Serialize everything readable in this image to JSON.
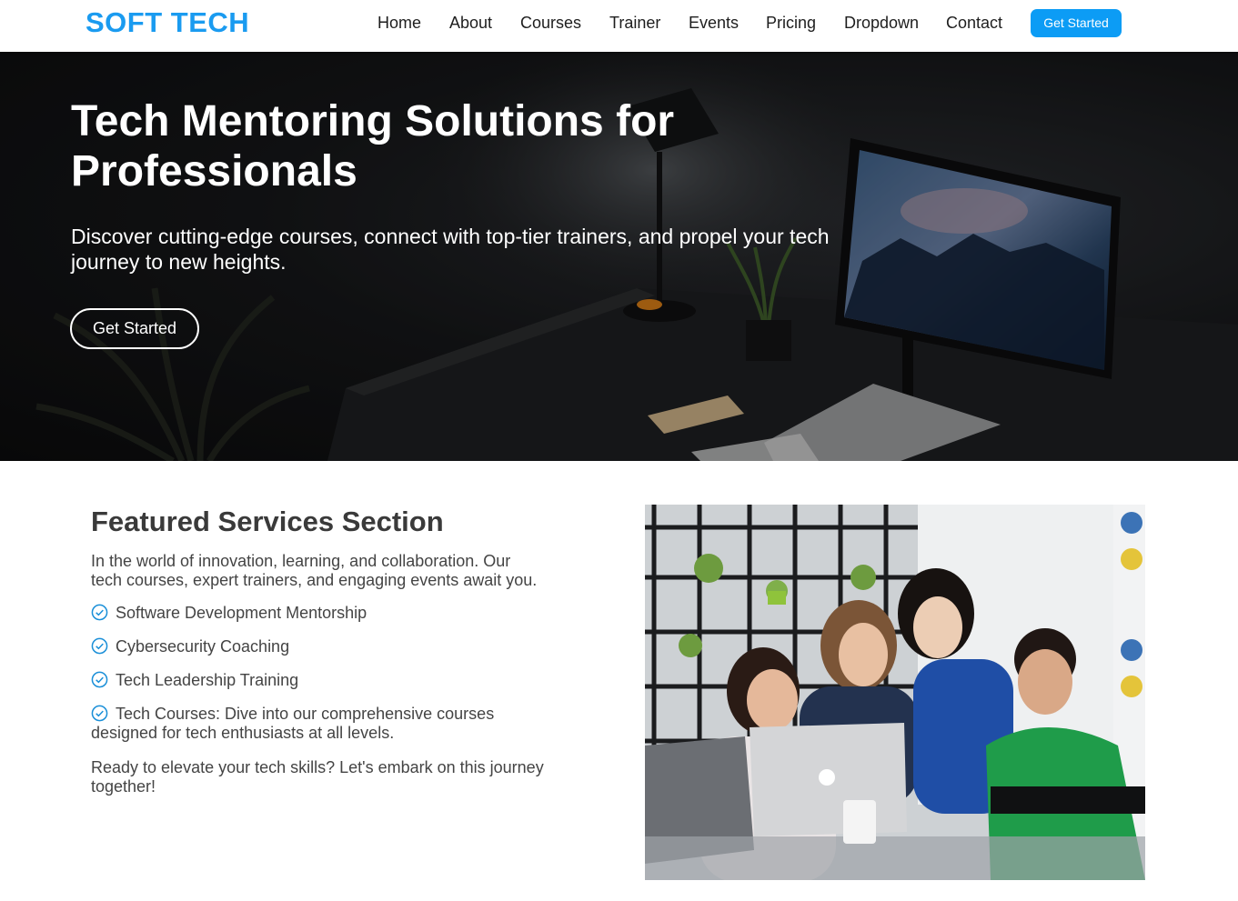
{
  "brand": {
    "name": "SOFT TECH",
    "color": "#1a9bf0"
  },
  "nav": {
    "items": [
      "Home",
      "About",
      "Courses",
      "Trainer",
      "Events",
      "Pricing",
      "Dropdown",
      "Contact"
    ],
    "cta": "Get Started"
  },
  "hero": {
    "title": "Tech Mentoring Solutions for Professionals",
    "subtitle": "Discover cutting-edge courses, connect with top-tier trainers, and propel your tech journey to new heights.",
    "button": "Get Started"
  },
  "featured": {
    "title": "Featured Services Section",
    "description": "In the world of innovation, learning, and collaboration. Our tech courses, expert trainers, and engaging events await you.",
    "items": [
      "Software Development Mentorship",
      "Cybersecurity Coaching",
      "Tech Leadership Training",
      "Tech Courses: Dive into our comprehensive courses designed for tech enthusiasts at all levels."
    ],
    "closing": "Ready to elevate your tech skills? Let's embark on this journey together!"
  },
  "colors": {
    "accent": "#0c9cf5",
    "check": "#1a8fd8"
  },
  "icons": {
    "check": "check-circle-icon"
  }
}
